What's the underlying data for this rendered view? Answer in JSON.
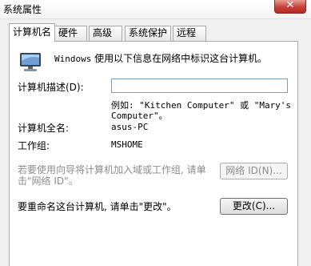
{
  "window": {
    "title": "系统属性",
    "close_label": "✕"
  },
  "tabs": [
    {
      "label": "计算机名",
      "active": true
    },
    {
      "label": "硬件",
      "active": false
    },
    {
      "label": "高级",
      "active": false
    },
    {
      "label": "系统保护",
      "active": false
    },
    {
      "label": "远程",
      "active": false
    }
  ],
  "intro": {
    "icon": "computer-monitor-icon",
    "prefix": "Windows",
    "text": " 使用以下信息在网络中标识这台计算机。"
  },
  "description": {
    "label": "计算机描述(D):",
    "value": "",
    "example_line1": "例如: \"Kitchen Computer\" 或 \"Mary's",
    "example_line2": "Computer\"。"
  },
  "full_name": {
    "label": "计算机全名:",
    "value": "asus-PC"
  },
  "workgroup": {
    "label": "工作组:",
    "value": "MSHOME"
  },
  "network_id": {
    "text_line1": "若要使用向导将计算机加入域或工作组, 请单",
    "text_line2": "击\"网络 ID\"。",
    "button_label": "网络 ID(N)..."
  },
  "rename": {
    "text": "要重命名这台计算机, 请单击\"更改\"。",
    "button_label": "更改(C)..."
  }
}
